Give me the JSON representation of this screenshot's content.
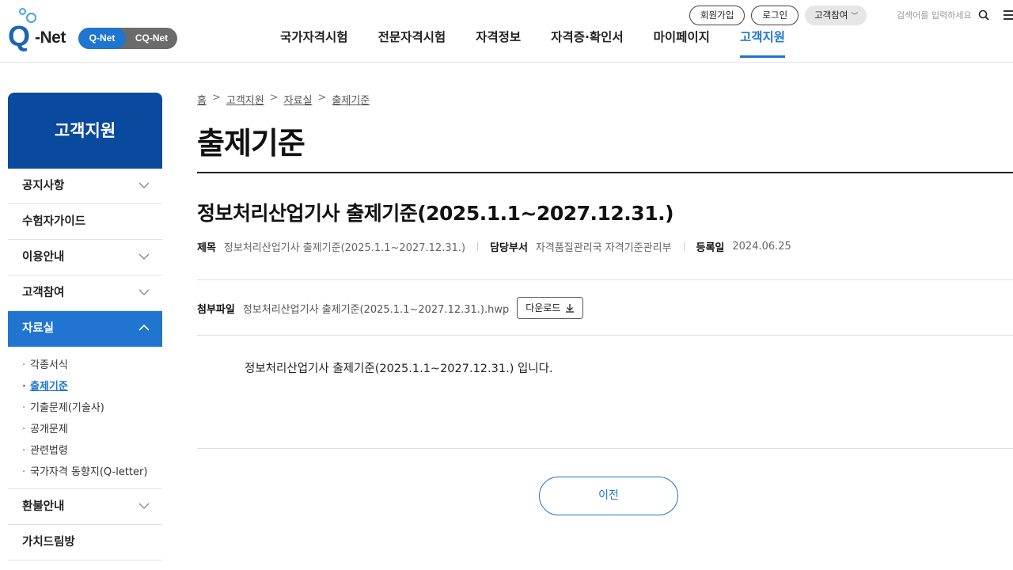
{
  "header": {
    "logo_text": "Q-Net",
    "net_switch": [
      "Q-Net",
      "CQ-Net"
    ],
    "gnb": [
      "국가자격시험",
      "전문자격시험",
      "자격정보",
      "자격증·확인서",
      "마이페이지",
      "고객지원"
    ],
    "util": {
      "signup": "회원가입",
      "login": "로그인",
      "customer": "고객참여",
      "search_placeholder": "검색어를 입력하세요"
    },
    "icons": {
      "search": "search-icon",
      "menu": "hamburger-menu-icon",
      "dropdown": "chevron-down-icon"
    }
  },
  "sidebar": {
    "title": "고객지원",
    "items": [
      {
        "label": "공지사항"
      },
      {
        "label": "수험자가이드"
      },
      {
        "label": "이용안내"
      },
      {
        "label": "고객참여"
      },
      {
        "label": "자료실"
      },
      {
        "label": "환불안내"
      },
      {
        "label": "가치드림방"
      }
    ],
    "sub_items": [
      "각종서식",
      "출제기준",
      "기출문제(기술사)",
      "공개문제",
      "관련법령",
      "국가자격 동향지(Q-letter)"
    ]
  },
  "breadcrumb": [
    "홈",
    "고객지원",
    "자료실",
    "출제기준"
  ],
  "page_title": "출제기준",
  "post": {
    "title": "정보처리산업기사 출제기준(2025.1.1~2027.12.31.)",
    "meta": {
      "subject_label": "제목",
      "subject_value": "정보처리산업기사 출제기준(2025.1.1~2027.12.31.)",
      "dept_label": "담당부서",
      "dept_value": "자격품질관리국 자격기준관리부",
      "date_label": "등록일",
      "date_value": "2024.06.25"
    },
    "attach_label": "첨부파일",
    "attach_file": "정보처리산업기사 출제기준(2025.1.1~2027.12.31.).hwp",
    "download_label": "다운로드",
    "body": "정보처리산업기사 출제기준(2025.1.1~2027.12.31.) 입니다."
  },
  "prev_button": "이전",
  "colors": {
    "primary": "#1f75d0",
    "navy": "#0a4a9e"
  }
}
